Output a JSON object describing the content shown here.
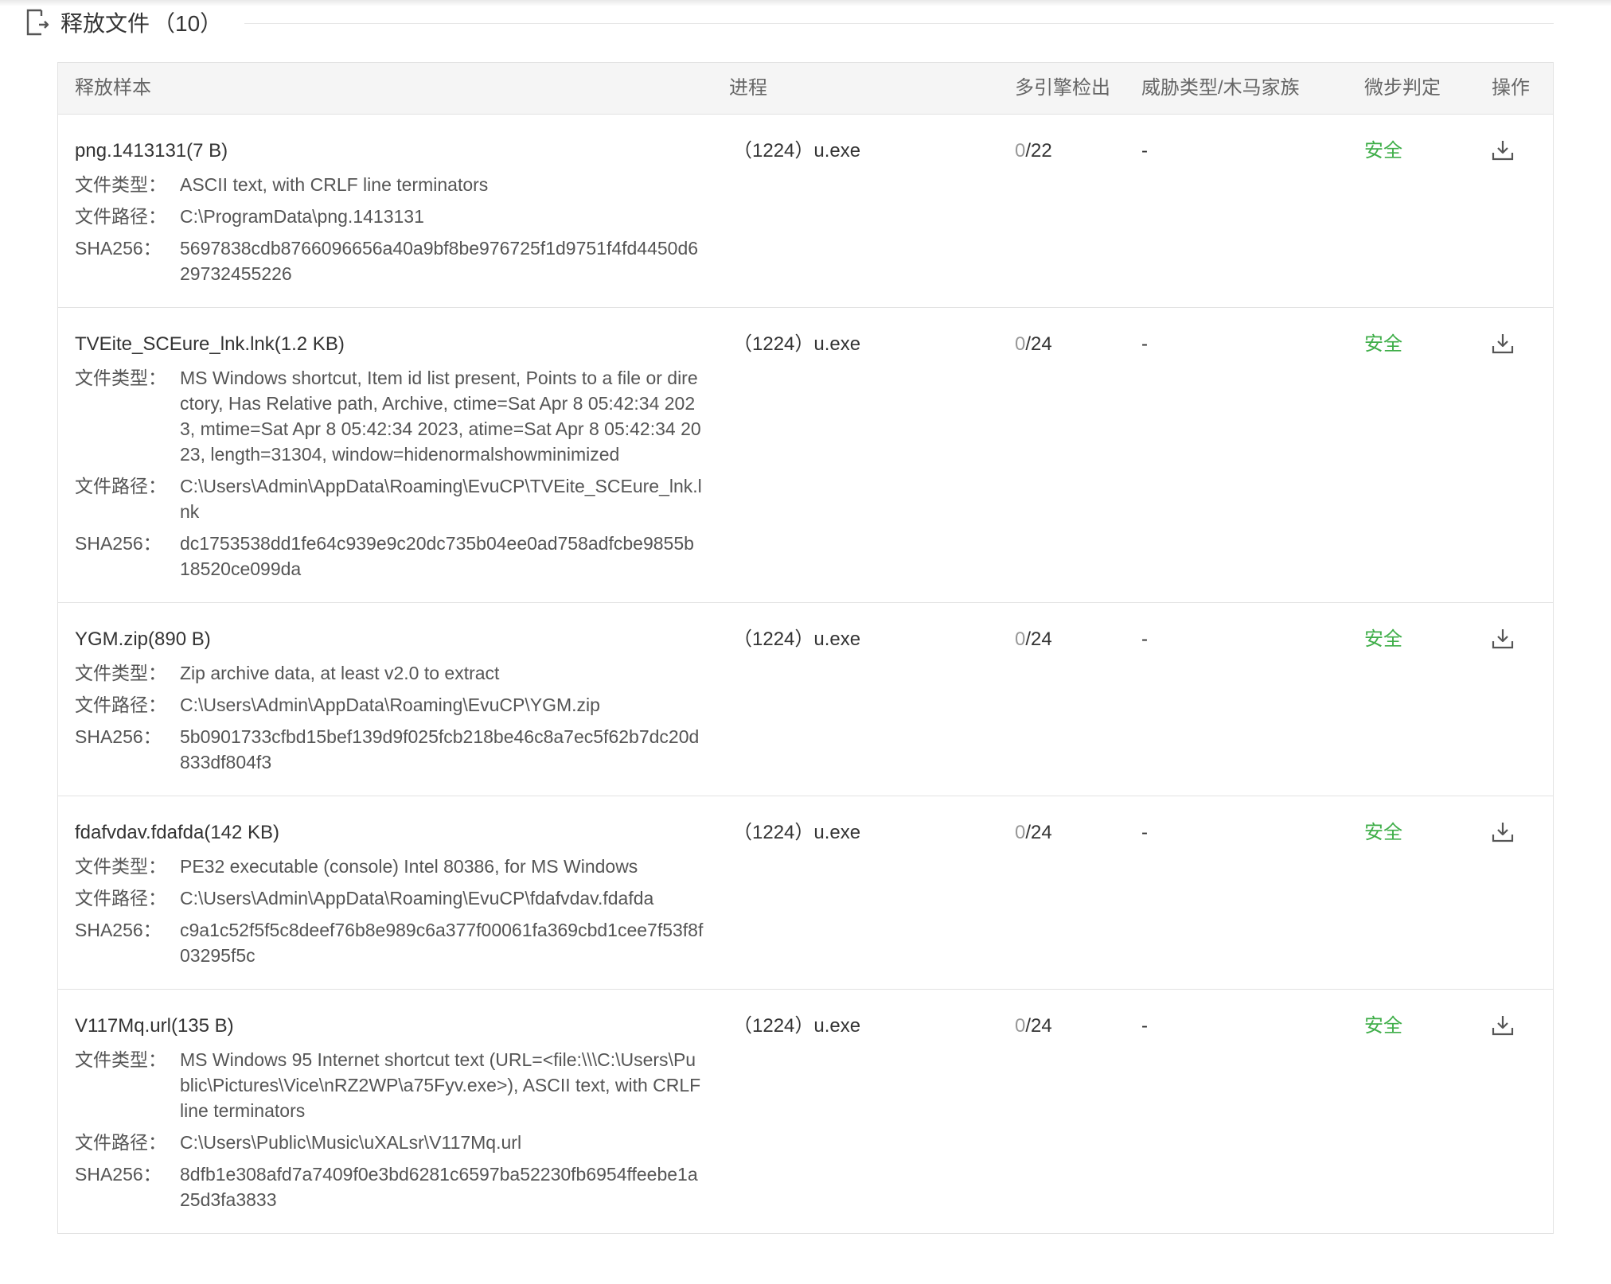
{
  "section": {
    "title": "释放文件",
    "count": "（10）",
    "icon": "file-export-icon"
  },
  "columns": {
    "sample": "释放样本",
    "process": "进程",
    "detection": "多引擎检出",
    "threat": "威胁类型/木马家族",
    "verdict": "微步判定",
    "action": "操作"
  },
  "labels": {
    "file_type": "文件类型：",
    "file_path": "文件路径：",
    "sha256": "SHA256："
  },
  "colors": {
    "safe": "#3fae49",
    "header_bg": "#f5f5f5",
    "border": "#e2e2e2"
  },
  "rows": [
    {
      "name": "png.1413131(7 B)",
      "file_type": "ASCII text, with CRLF line terminators",
      "file_path": "C:\\ProgramData\\png.1413131",
      "sha256": "5697838cdb8766096656a40a9bf8be976725f1d9751f4fd4450d629732455226",
      "process": "（1224）u.exe",
      "det_hits": "0",
      "det_total": "/22",
      "threat": "-",
      "verdict": "安全"
    },
    {
      "name": "TVEite_SCEure_lnk.lnk(1.2 KB)",
      "file_type": "MS Windows shortcut, Item id list present, Points to a file or directory, Has Relative path, Archive, ctime=Sat Apr 8 05:42:34 2023, mtime=Sat Apr 8 05:42:34 2023, atime=Sat Apr 8 05:42:34 2023, length=31304, window=hidenormalshowminimized",
      "file_path": "C:\\Users\\Admin\\AppData\\Roaming\\EvuCP\\TVEite_SCEure_lnk.lnk",
      "sha256": "dc1753538dd1fe64c939e9c20dc735b04ee0ad758adfcbe9855b18520ce099da",
      "process": "（1224）u.exe",
      "det_hits": "0",
      "det_total": "/24",
      "threat": "-",
      "verdict": "安全"
    },
    {
      "name": "YGM.zip(890 B)",
      "file_type": "Zip archive data, at least v2.0 to extract",
      "file_path": "C:\\Users\\Admin\\AppData\\Roaming\\EvuCP\\YGM.zip",
      "sha256": "5b0901733cfbd15bef139d9f025fcb218be46c8a7ec5f62b7dc20d833df804f3",
      "process": "（1224）u.exe",
      "det_hits": "0",
      "det_total": "/24",
      "threat": "-",
      "verdict": "安全"
    },
    {
      "name": "fdafvdav.fdafda(142 KB)",
      "file_type": "PE32 executable (console) Intel 80386, for MS Windows",
      "file_path": "C:\\Users\\Admin\\AppData\\Roaming\\EvuCP\\fdafvdav.fdafda",
      "sha256": "c9a1c52f5f5c8deef76b8e989c6a377f00061fa369cbd1cee7f53f8f03295f5c",
      "process": "（1224）u.exe",
      "det_hits": "0",
      "det_total": "/24",
      "threat": "-",
      "verdict": "安全"
    },
    {
      "name": "V117Mq.url(135 B)",
      "file_type": "MS Windows 95 Internet shortcut text (URL=<file:\\\\\\C:\\Users\\Public\\Pictures\\Vice\\nRZ2WP\\a75Fyv.exe>), ASCII text, with CRLF line terminators",
      "file_path": "C:\\Users\\Public\\Music\\uXALsr\\V117Mq.url",
      "sha256": "8dfb1e308afd7a7409f0e3bd6281c6597ba52230fb6954ffeebe1a25d3fa3833",
      "process": "（1224）u.exe",
      "det_hits": "0",
      "det_total": "/24",
      "threat": "-",
      "verdict": "安全"
    }
  ]
}
